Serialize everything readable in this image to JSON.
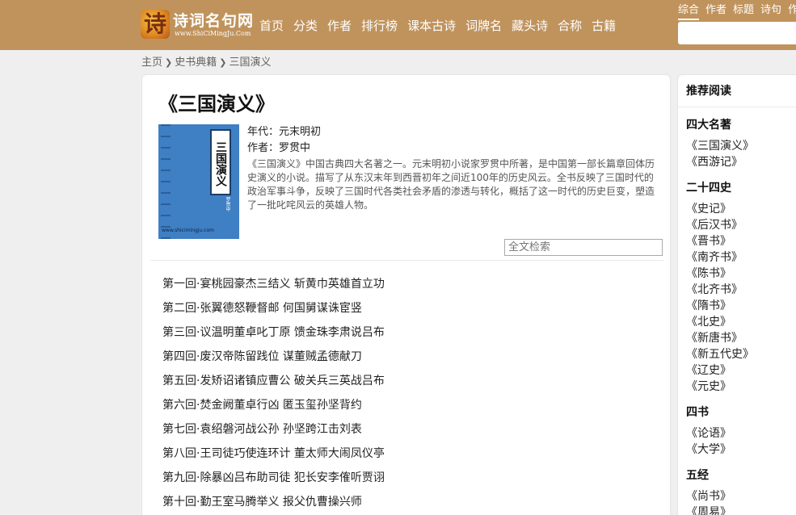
{
  "header": {
    "logo_mark": "诗",
    "logo_name": "诗词名句网",
    "logo_url": "www.ShiCiMingJu.Com",
    "nav": [
      "首页",
      "分类",
      "作者",
      "排行榜",
      "课本古诗",
      "词牌名",
      "藏头诗",
      "合称",
      "古籍"
    ],
    "search_tabs": [
      "综合",
      "作者",
      "标题",
      "诗句",
      "作"
    ],
    "search_active": "综合"
  },
  "breadcrumb": [
    "主页",
    "史书典籍",
    "三国演义"
  ],
  "book": {
    "title": "《三国演义》",
    "cover_title": "三国演义",
    "cover_author": "罗贯中",
    "cover_url": "www.shicimingju.com",
    "era_label": "年代：",
    "era": "元末明初",
    "author_label": "作者：",
    "author": "罗贯中",
    "intro": "《三国演义》中国古典四大名著之一。元末明初小说家罗贯中所著，是中国第一部长篇章回体历史演义的小说。描写了从东汉末年到西晋初年之间近100年的历史风云。全书反映了三国时代的政治军事斗争，反映了三国时代各类社会矛盾的渗透与转化，概括了这一时代的历史巨变，塑造了一批叱咤风云的英雄人物。",
    "search_placeholder": "全文检索"
  },
  "chapters": [
    "第一回·宴桃园豪杰三结义 斩黄巾英雄首立功",
    "第二回·张翼德怒鞭督邮 何国舅谋诛宦竖",
    "第三回·议温明董卓叱丁原 馈金珠李肃说吕布",
    "第四回·废汉帝陈留践位 谋董贼孟德献刀",
    "第五回·发矫诏诸镇应曹公 破关兵三英战吕布",
    "第六回·焚金阙董卓行凶 匿玉玺孙坚背约",
    "第七回·袁绍磐河战公孙 孙坚跨江击刘表",
    "第八回·王司徒巧使连环计 董太师大闹凤仪亭",
    "第九回·除暴凶吕布助司徒 犯长安李傕听贾诩",
    "第十回·勤王室马腾举义 报父仇曹操兴师"
  ],
  "sidebar": {
    "heading": "推荐阅读",
    "groups": [
      {
        "title": "四大名著",
        "items": [
          "《三国演义》",
          "《西游记》"
        ]
      },
      {
        "title": "二十四史",
        "items": [
          "《史记》",
          "《后汉书》",
          "《晋书》",
          "《南齐书》",
          "《陈书》",
          "《北齐书》",
          "《隋书》",
          "《北史》",
          "《新唐书》",
          "《新五代史》",
          "《辽史》",
          "《元史》"
        ]
      },
      {
        "title": "四书",
        "items": [
          "《论语》",
          "《大学》"
        ]
      },
      {
        "title": "五经",
        "items": [
          "《尚书》",
          "《周易》"
        ]
      }
    ]
  }
}
